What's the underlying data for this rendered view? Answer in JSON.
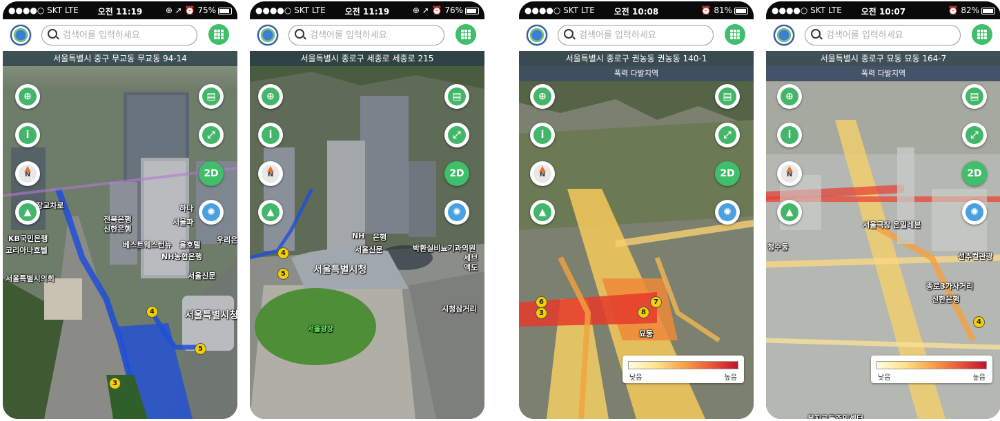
{
  "screens": [
    {
      "status": {
        "carrier": "●●●●○ SKT  LTE",
        "time": "오전 11:19",
        "right": "⊕ ➚ ⏰ 75%",
        "battery": 75
      },
      "search_placeholder": "검색어를 입력하세요",
      "address": "서울특별시 중구 무교동 무교동 94-14",
      "labels": [
        "장교차로",
        "전북은행",
        "신한은행",
        "KB국민은행",
        "코리아나호텔",
        "하나",
        "서울파",
        "베스트웨스턴뉴",
        "을호텔",
        "NH농협은행",
        "우리은",
        "서울특별시의회",
        "서울신문",
        "서울특별시청"
      ],
      "stations": [
        "4",
        "5",
        "3"
      ],
      "btn_2d": "2D"
    },
    {
      "status": {
        "carrier": "●●●●○ SKT  LTE",
        "time": "오전 11:19",
        "right": "⊕ ➚ ⏰ 76%",
        "battery": 76
      },
      "search_placeholder": "검색어를 입력하세요",
      "address": "서울특별시 종로구 세종로 세종로 215",
      "labels": [
        "NH",
        "은행",
        "서울신문",
        "박환실비뇨기과의원",
        "세브",
        "액도",
        "서울특별시청",
        "시청삼거리",
        "서울광장"
      ],
      "stations": [
        "4",
        "5"
      ],
      "btn_2d": "2D"
    },
    {
      "status": {
        "carrier": "●●●●○ SKT  LTE",
        "time": "오전 10:08",
        "right": "⏰ 81%",
        "battery": 81
      },
      "search_placeholder": "검색어를 입력하세요",
      "address": "서울특별시 종로구 권농동 권농동 140-1",
      "note": "폭력 다발지역",
      "labels": [
        "묘동"
      ],
      "stations": [
        "6",
        "3",
        "7",
        "8"
      ],
      "legend": {
        "low": "낮음",
        "high": "높음"
      },
      "btn_2d": "2D"
    },
    {
      "status": {
        "carrier": "●●●●○ SKT  LTE",
        "time": "오전 10:07",
        "right": "⏰ 82%",
        "battery": 82
      },
      "search_placeholder": "검색어를 입력하세요",
      "address": "서울특별시 종로구 묘동 묘동 164-7",
      "note": "폭력 다발지역",
      "labels": [
        "서울극장",
        "은일레븐",
        "청수동",
        "종로3가사거리",
        "신한은행",
        "을지로동주민센터",
        "선추컬관광"
      ],
      "stations": [
        "4"
      ],
      "legend": {
        "low": "낮음",
        "high": "높음"
      },
      "btn_2d": "2D"
    }
  ],
  "colors": {
    "accent": "#3fbf6a",
    "searchBorder": "#9a9a9a",
    "addressBar": "#2f4650",
    "subwayLine": "#1f4fd8",
    "heatLow": "#fffbe0",
    "heatHigh": "#c4122e"
  },
  "icons": [
    "app-logo-icon",
    "search-icon",
    "grid-menu-icon",
    "location-target-icon",
    "shield-info-icon",
    "compass-icon",
    "hiking-icon",
    "layers-icon",
    "fullscreen-icon",
    "siren-icon"
  ]
}
